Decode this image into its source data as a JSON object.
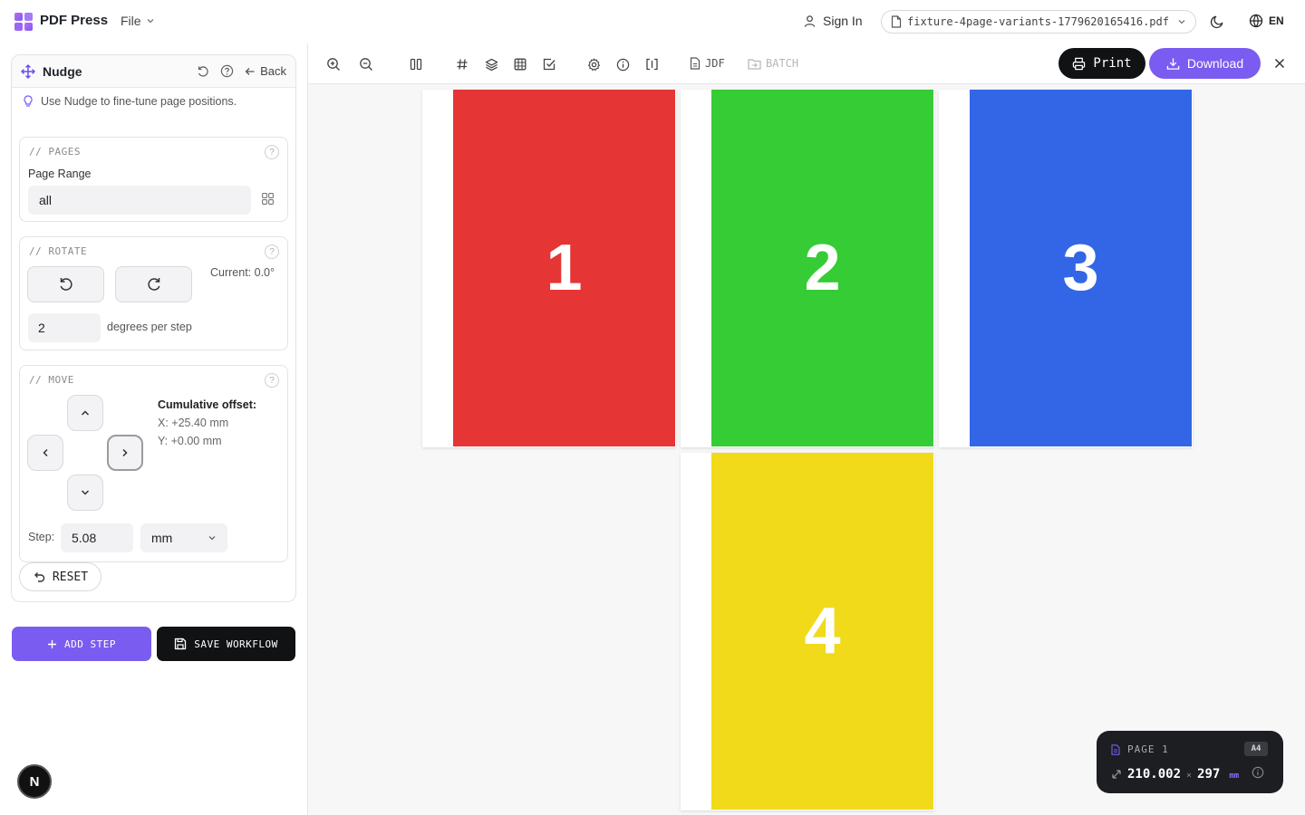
{
  "app": {
    "name": "PDF Press",
    "file_menu": "File",
    "sign_in": "Sign In",
    "file_name": "fixture-4page-variants-1779620165416.pdf",
    "language": "EN",
    "colors": {
      "accent": "#7b5cf0",
      "dark": "#111214"
    }
  },
  "panel": {
    "title": "Nudge",
    "back": "Back",
    "hint": "Use Nudge to fine-tune page positions.",
    "pages": {
      "section_label": "// PAGES",
      "range_label": "Page Range",
      "range_value": "all"
    },
    "rotate": {
      "section_label": "// ROTATE",
      "current": "Current: 0.0°",
      "step_value": "2",
      "step_label": "degrees per step"
    },
    "move": {
      "section_label": "// MOVE",
      "offset_title": "Cumulative offset:",
      "offset_x": "X: +25.40 mm",
      "offset_y": "Y: +0.00 mm",
      "step_label": "Step:",
      "step_value": "5.08",
      "unit": "mm"
    },
    "reset": "RESET",
    "help": "?"
  },
  "actions": {
    "add_step": "ADD STEP",
    "save_workflow": "SAVE WORKFLOW"
  },
  "badge": "N",
  "toolbar": {
    "jdf": "JDF",
    "batch": "BATCH",
    "print": "Print",
    "download": "Download"
  },
  "pages": [
    {
      "number": "1",
      "color": "#e53535"
    },
    {
      "number": "2",
      "color": "#35cc35"
    },
    {
      "number": "3",
      "color": "#3366e6"
    },
    {
      "number": "4",
      "color": "#f0da1a"
    }
  ],
  "page_info": {
    "label": "PAGE 1",
    "size_badge": "A4",
    "width": "210.002",
    "sep": "×",
    "height": "297",
    "unit": "mm"
  }
}
